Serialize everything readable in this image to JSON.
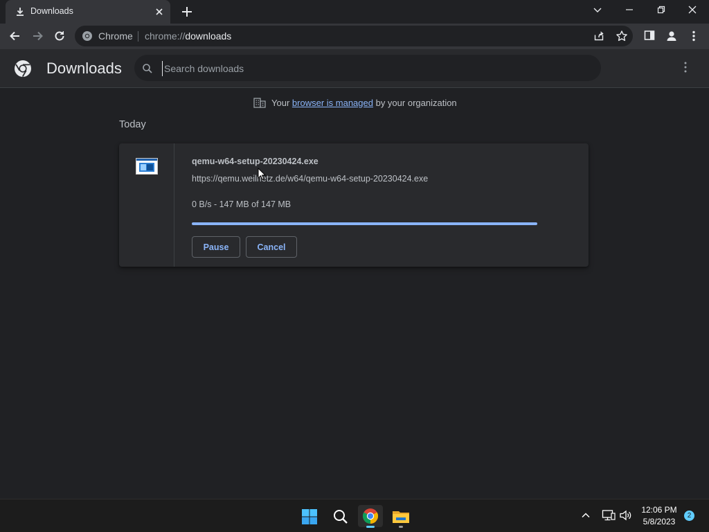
{
  "tab": {
    "title": "Downloads",
    "icon": "download-icon"
  },
  "window_controls": {
    "icons": [
      "tab-search-icon",
      "minimize-icon",
      "restore-icon",
      "close-icon"
    ]
  },
  "omnibox": {
    "chip": "Chrome",
    "url_scheme": "chrome://",
    "url_host": "downloads"
  },
  "downloads_page": {
    "title": "Downloads",
    "search_placeholder": "Search downloads"
  },
  "managed_notice": {
    "before": "Your",
    "link": "browser is managed",
    "after": "by your organization"
  },
  "group_label": "Today",
  "download": {
    "file_name": "qemu-w64-setup-20230424.exe",
    "url": "https://qemu.weilnetz.de/w64/qemu-w64-setup-20230424.exe",
    "status": "0 B/s - 147 MB of 147 MB",
    "progress_fraction": 1.0,
    "pause_label": "Pause",
    "cancel_label": "Cancel"
  },
  "taskbar": {
    "apps": [
      "start-icon",
      "search-icon",
      "chrome-icon",
      "file-explorer-icon"
    ],
    "time": "12:06 PM",
    "date": "5/8/2023",
    "notification_count": "2"
  },
  "colors": {
    "background": "#202124",
    "toolbar": "#35363a",
    "card": "#292a2d",
    "accent": "#8ab4f8",
    "taskbar_accent": "#60cdff"
  }
}
